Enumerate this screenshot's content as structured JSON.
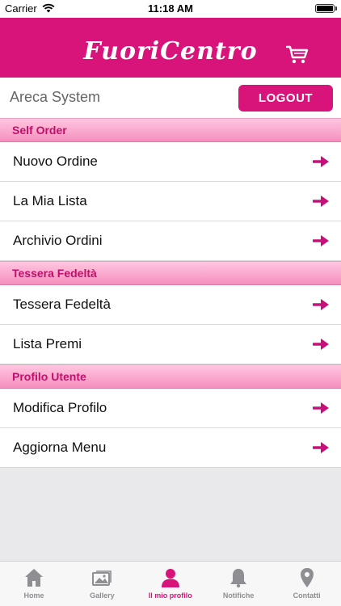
{
  "status_bar": {
    "carrier": "Carrier",
    "time": "11:18 AM"
  },
  "header": {
    "logo": "FuoriCentro",
    "cart_icon": "cart-icon",
    "color": "#d8147a"
  },
  "user": {
    "name": "Areca System",
    "logout_label": "LOGOUT"
  },
  "sections": [
    {
      "title": "Self Order",
      "items": [
        "Nuovo Ordine",
        "La Mia Lista",
        "Archivio Ordini"
      ]
    },
    {
      "title": "Tessera Fedeltà",
      "items": [
        "Tessera Fedeltà",
        "Lista Premi"
      ]
    },
    {
      "title": "Profilo Utente",
      "items": [
        "Modifica Profilo",
        "Aggiorna Menu"
      ]
    }
  ],
  "tabs": [
    {
      "label": "Home",
      "icon": "home-icon"
    },
    {
      "label": "Gallery",
      "icon": "gallery-icon"
    },
    {
      "label": "Il mio profilo",
      "icon": "profile-icon",
      "active": true
    },
    {
      "label": "Notifiche",
      "icon": "bell-icon"
    },
    {
      "label": "Contatti",
      "icon": "location-pin-icon"
    }
  ],
  "colors": {
    "accent": "#d8147a",
    "tab_inactive": "#8e8e93",
    "section_bg": "#f9a8cc"
  }
}
